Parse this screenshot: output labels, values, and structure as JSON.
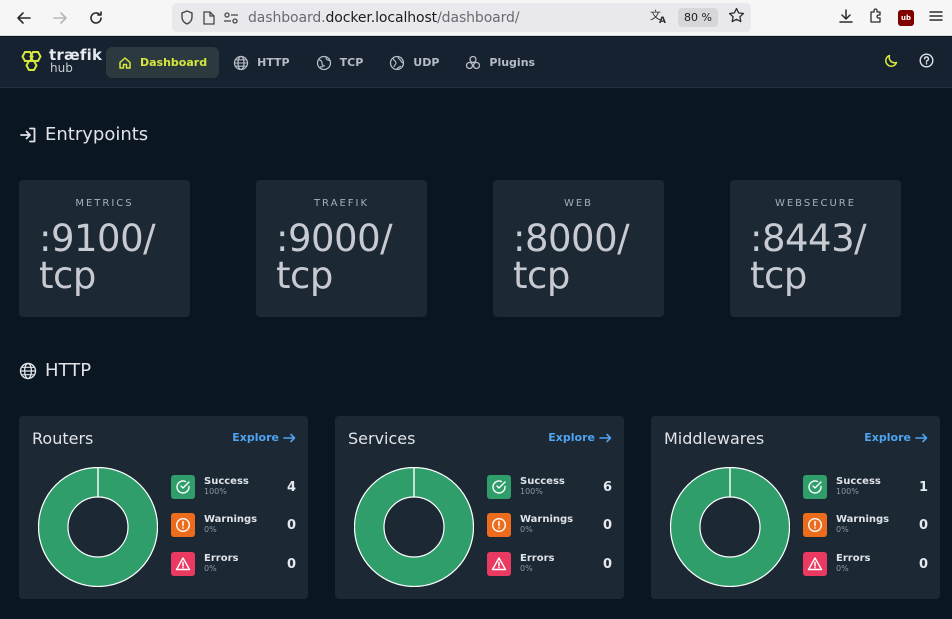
{
  "browser": {
    "url_prefix": "dashboard.",
    "url_host": "docker.localhost",
    "url_path": "/dashboard/",
    "zoom": "80 %",
    "ublock_badge": "ub"
  },
  "header": {
    "logo_top": "træfik",
    "logo_bottom": "hub",
    "nav": [
      {
        "label": "Dashboard",
        "icon": "home-icon",
        "active": true
      },
      {
        "label": "HTTP",
        "icon": "globe-icon"
      },
      {
        "label": "TCP",
        "icon": "tcp-icon"
      },
      {
        "label": "UDP",
        "icon": "udp-icon"
      },
      {
        "label": "Plugins",
        "icon": "plugins-icon"
      }
    ]
  },
  "entrypoints": {
    "title": "Entrypoints",
    "items": [
      {
        "name": "METRICS",
        "address": ":9100/\ntcp"
      },
      {
        "name": "TRAEFIK",
        "address": ":9000/\ntcp"
      },
      {
        "name": "WEB",
        "address": ":8000/\ntcp"
      },
      {
        "name": "WEBSECURE",
        "address": ":8443/\ntcp"
      }
    ]
  },
  "http": {
    "title": "HTTP",
    "explore_label": "Explore",
    "cards": [
      {
        "title": "Routers",
        "success": {
          "label": "Success",
          "pct": "100%",
          "count": "4"
        },
        "warnings": {
          "label": "Warnings",
          "pct": "0%",
          "count": "0"
        },
        "errors": {
          "label": "Errors",
          "pct": "0%",
          "count": "0"
        }
      },
      {
        "title": "Services",
        "success": {
          "label": "Success",
          "pct": "100%",
          "count": "6"
        },
        "warnings": {
          "label": "Warnings",
          "pct": "0%",
          "count": "0"
        },
        "errors": {
          "label": "Errors",
          "pct": "0%",
          "count": "0"
        }
      },
      {
        "title": "Middlewares",
        "success": {
          "label": "Success",
          "pct": "100%",
          "count": "1"
        },
        "warnings": {
          "label": "Warnings",
          "pct": "0%",
          "count": "0"
        },
        "errors": {
          "label": "Errors",
          "pct": "0%",
          "count": "0"
        }
      }
    ]
  },
  "colors": {
    "success": "#2f9e6a",
    "warning": "#ec6b1c",
    "error": "#ea3a62",
    "accent": "#d6e83d",
    "link": "#4ea4f0"
  }
}
